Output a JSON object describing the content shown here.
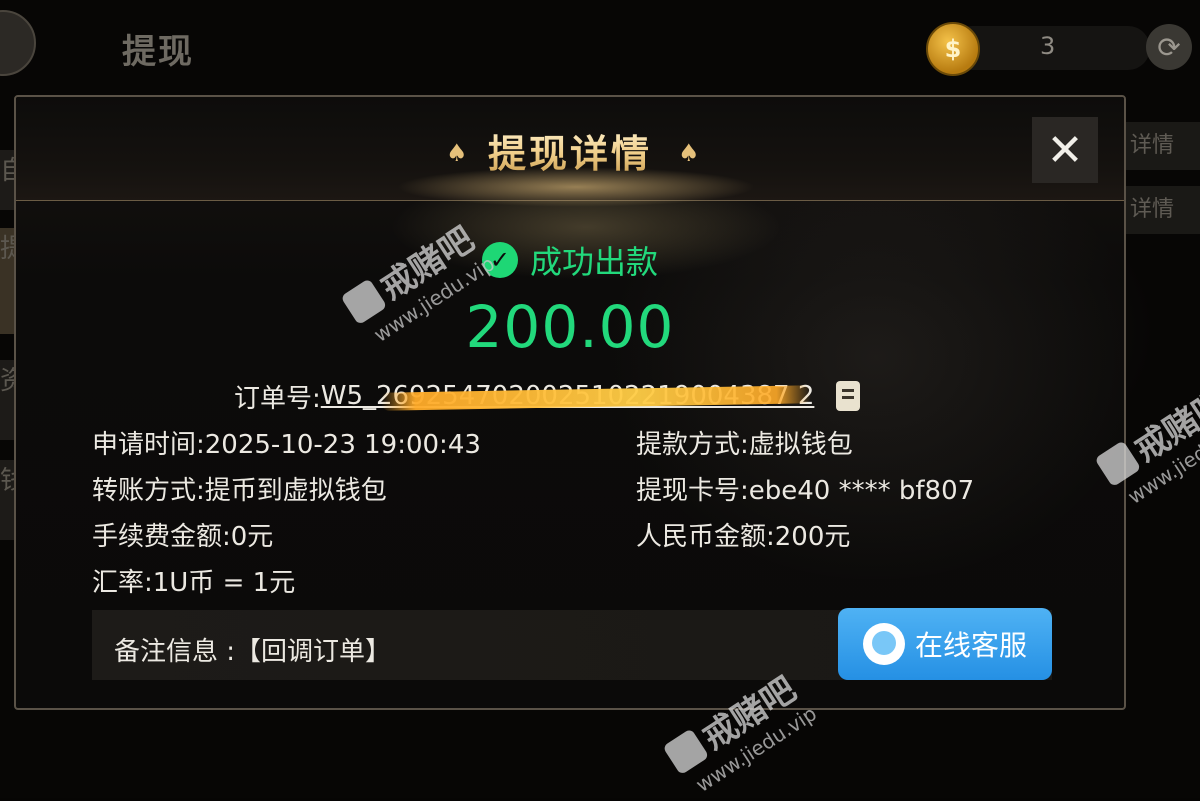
{
  "app": {
    "title": "提现",
    "balance": "3",
    "coin_glyph": "$"
  },
  "background_tabs": {
    "right": [
      "详情",
      "详情"
    ],
    "left": [
      "自",
      "提",
      "资",
      "钱"
    ]
  },
  "modal": {
    "title": "提现详情",
    "close_glyph": "✕",
    "status": "成功出款",
    "amount": "200.00",
    "order_label": "订单号:",
    "order_value": "W5_2692547020025102219004387 2",
    "fields_left": [
      {
        "label": "申请时间:",
        "value": "2025-10-23 19:00:43"
      },
      {
        "label": "转账方式:",
        "value": "提币到虚拟钱包"
      },
      {
        "label": "手续费金额:",
        "value": "0元"
      },
      {
        "label": "汇率:",
        "value": "1U币 = 1元"
      }
    ],
    "fields_right": [
      {
        "label": "提款方式:",
        "value": "虚拟钱包"
      },
      {
        "label": "提现卡号:",
        "value": "ebe40 **** bf807"
      },
      {
        "label": "人民币金额:",
        "value": "200元"
      }
    ],
    "remark": "备注信息 :【回调订单】",
    "service_button": "在线客服"
  },
  "watermark": {
    "text": "戒赌吧",
    "url": "www.jiedu.vip"
  },
  "colors": {
    "success": "#22d97c",
    "gold": "#e5c07a",
    "service_blue": "#2f9be8"
  }
}
